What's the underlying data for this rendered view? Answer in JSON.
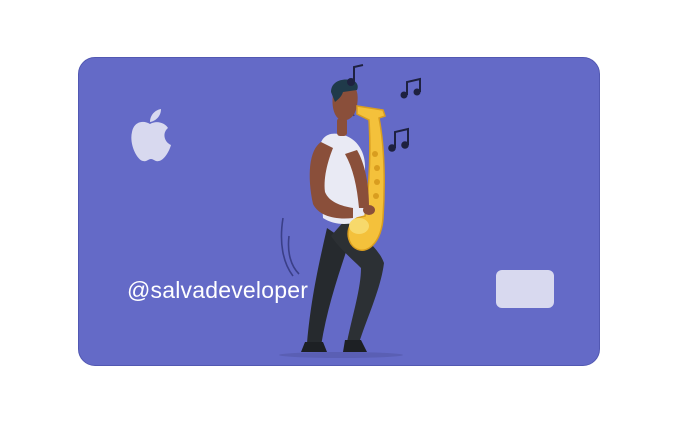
{
  "card": {
    "handle": "@salvadeveloper",
    "brand_icon": "apple-logo-icon",
    "chip_icon": "card-chip",
    "illustration": "saxophone-player-illustration",
    "notes_icons": [
      "music-note-icon",
      "double-music-note-icon",
      "double-music-note-icon"
    ]
  },
  "colors": {
    "card_background": "#646ac7",
    "chip": "#d8d9ef",
    "logo": "#d8d9ef",
    "text": "#ffffff",
    "saxophone": "#f4c13b"
  }
}
